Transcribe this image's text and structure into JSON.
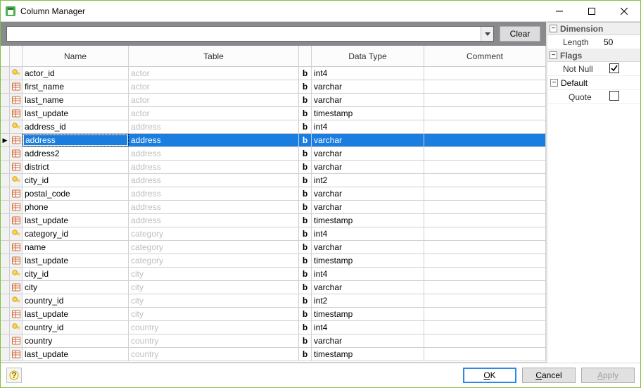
{
  "window": {
    "title": "Column Manager"
  },
  "filter": {
    "value": "",
    "clear_label": "Clear"
  },
  "grid": {
    "headers": {
      "name": "Name",
      "table": "Table",
      "datatype": "Data Type",
      "comment": "Comment"
    },
    "selected_index": 5,
    "rows": [
      {
        "icon": "key",
        "name": "actor_id",
        "table": "actor",
        "dt": "int4",
        "comment": ""
      },
      {
        "icon": "col",
        "name": "first_name",
        "table": "actor",
        "dt": "varchar",
        "comment": ""
      },
      {
        "icon": "col",
        "name": "last_name",
        "table": "actor",
        "dt": "varchar",
        "comment": ""
      },
      {
        "icon": "col",
        "name": "last_update",
        "table": "actor",
        "dt": "timestamp",
        "comment": ""
      },
      {
        "icon": "key",
        "name": "address_id",
        "table": "address",
        "dt": "int4",
        "comment": ""
      },
      {
        "icon": "col",
        "name": "address",
        "table": "address",
        "dt": "varchar",
        "comment": ""
      },
      {
        "icon": "col",
        "name": "address2",
        "table": "address",
        "dt": "varchar",
        "comment": ""
      },
      {
        "icon": "col",
        "name": "district",
        "table": "address",
        "dt": "varchar",
        "comment": ""
      },
      {
        "icon": "key",
        "name": "city_id",
        "table": "address",
        "dt": "int2",
        "comment": ""
      },
      {
        "icon": "col",
        "name": "postal_code",
        "table": "address",
        "dt": "varchar",
        "comment": ""
      },
      {
        "icon": "col",
        "name": "phone",
        "table": "address",
        "dt": "varchar",
        "comment": ""
      },
      {
        "icon": "col",
        "name": "last_update",
        "table": "address",
        "dt": "timestamp",
        "comment": ""
      },
      {
        "icon": "key",
        "name": "category_id",
        "table": "category",
        "dt": "int4",
        "comment": ""
      },
      {
        "icon": "col",
        "name": "name",
        "table": "category",
        "dt": "varchar",
        "comment": ""
      },
      {
        "icon": "col",
        "name": "last_update",
        "table": "category",
        "dt": "timestamp",
        "comment": ""
      },
      {
        "icon": "key",
        "name": "city_id",
        "table": "city",
        "dt": "int4",
        "comment": ""
      },
      {
        "icon": "col",
        "name": "city",
        "table": "city",
        "dt": "varchar",
        "comment": ""
      },
      {
        "icon": "key",
        "name": "country_id",
        "table": "city",
        "dt": "int2",
        "comment": ""
      },
      {
        "icon": "col",
        "name": "last_update",
        "table": "city",
        "dt": "timestamp",
        "comment": ""
      },
      {
        "icon": "key",
        "name": "country_id",
        "table": "country",
        "dt": "int4",
        "comment": ""
      },
      {
        "icon": "col",
        "name": "country",
        "table": "country",
        "dt": "varchar",
        "comment": ""
      },
      {
        "icon": "col",
        "name": "last_update",
        "table": "country",
        "dt": "timestamp",
        "comment": ""
      }
    ]
  },
  "props": {
    "dimension_label": "Dimension",
    "length_label": "Length",
    "length_value": "50",
    "flags_label": "Flags",
    "notnull_label": "Not Null",
    "notnull_checked": true,
    "default_label": "Default",
    "quote_label": "Quote",
    "quote_checked": false
  },
  "footer": {
    "ok": "OK",
    "cancel": "Cancel",
    "apply": "Apply"
  }
}
